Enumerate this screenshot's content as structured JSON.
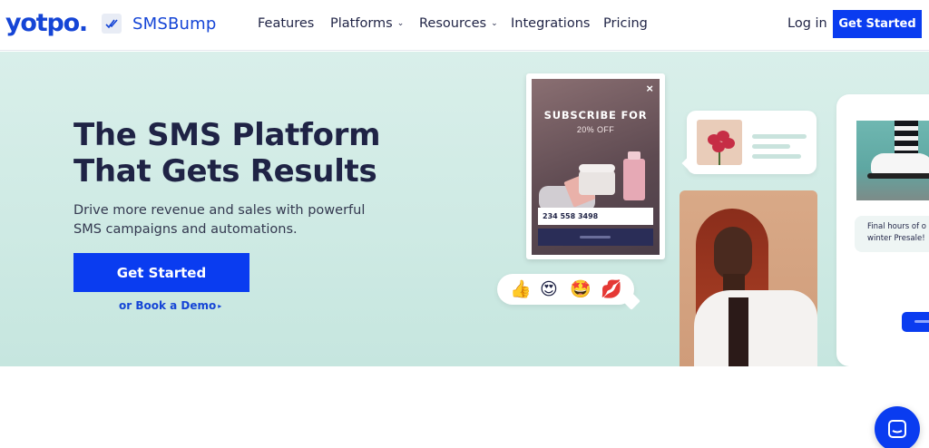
{
  "nav": {
    "logo": "yotpo.",
    "brand": "SMSBump",
    "items": [
      {
        "label": "Features",
        "has_dropdown": false
      },
      {
        "label": "Platforms",
        "has_dropdown": true
      },
      {
        "label": "Resources",
        "has_dropdown": true
      },
      {
        "label": "Integrations",
        "has_dropdown": false
      },
      {
        "label": "Pricing",
        "has_dropdown": false
      }
    ],
    "login": "Log in",
    "cta": "Get Started"
  },
  "hero": {
    "title_line1": "The SMS Platform",
    "title_line2": "That Gets Results",
    "subtitle_line1": "Drive more revenue and sales with powerful",
    "subtitle_line2": "SMS campaigns and automations.",
    "cta": "Get Started",
    "demo_link": "or Book a Demo",
    "demo_arrow": "▸"
  },
  "popup": {
    "close": "×",
    "heading": "SUBSCRIBE FOR",
    "offer": "20% OFF",
    "phone_value": "234 558 3498"
  },
  "reactions": [
    "👍",
    "😍",
    "🤩",
    "💋"
  ],
  "sms_card": {
    "line1": "Final hours of o",
    "line2": "winter Presale!"
  },
  "colors": {
    "brand": "#1545d6",
    "cta": "#0a3cf0",
    "hero_bg": "#d9efea",
    "text": "#1f2345"
  }
}
